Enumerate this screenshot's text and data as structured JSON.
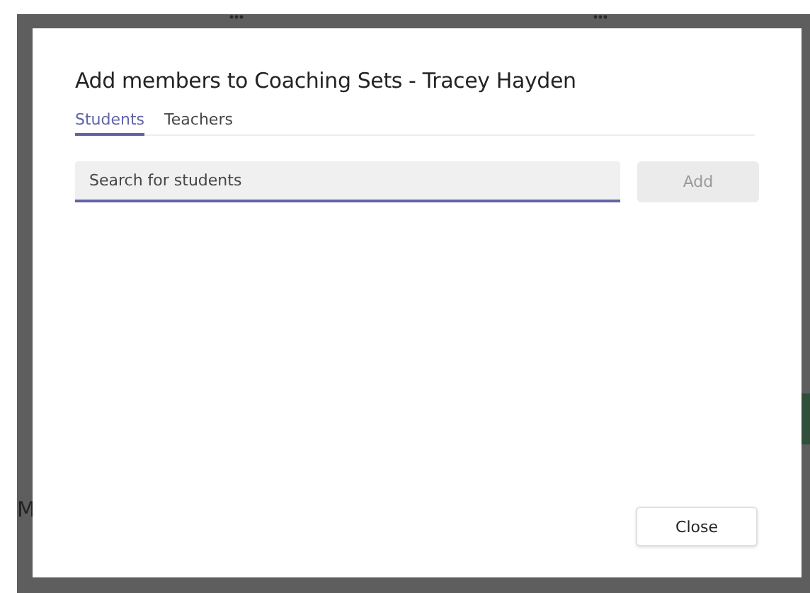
{
  "background": {
    "fragment": "M"
  },
  "dialog": {
    "title": "Add members to Coaching Sets - Tracey Hayden",
    "tabs": [
      {
        "label": "Students",
        "selected": true
      },
      {
        "label": "Teachers",
        "selected": false
      }
    ],
    "search": {
      "placeholder": "Search for students"
    },
    "add_button": {
      "label": "Add",
      "disabled": true
    },
    "close_button": {
      "label": "Close"
    }
  }
}
